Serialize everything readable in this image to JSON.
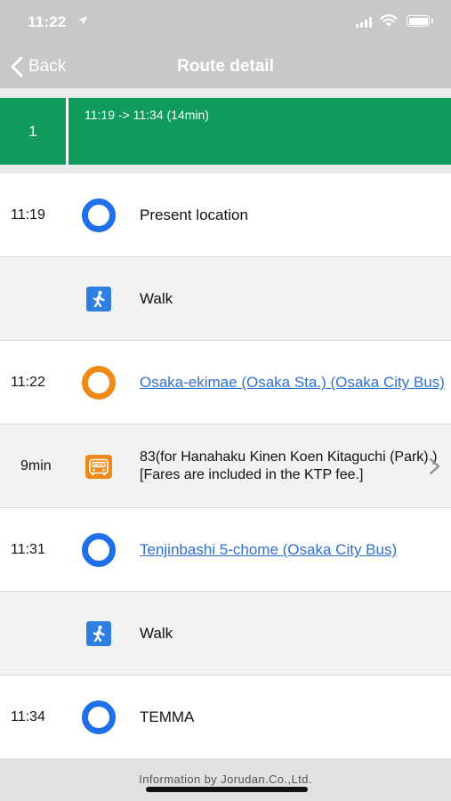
{
  "status_bar": {
    "time": "11:22"
  },
  "nav": {
    "back_label": "Back",
    "title": "Route detail"
  },
  "route_summary": {
    "number": "1",
    "time_range": "11:19 -> 11:34 (14min)"
  },
  "steps": [
    {
      "time": "11:19",
      "text": "Present location"
    },
    {
      "icon": "walk-icon",
      "text": "Walk"
    },
    {
      "time": "11:22",
      "text": "Osaka-ekimae (Osaka Sta.) (Osaka City Bus)"
    },
    {
      "duration": "9min",
      "icon": "bus-icon",
      "text": "83(for Hanahaku Kinen Koen Kitaguchi (Park) ) [Fares are included in the KTP fee.]"
    },
    {
      "time": "11:31",
      "text": "Tenjinbashi 5-chome (Osaka City Bus)"
    },
    {
      "icon": "walk-icon",
      "text": "Walk"
    },
    {
      "time": "11:34",
      "text": "TEMMA"
    }
  ],
  "colors": {
    "header_bg": "#c8c8c8",
    "route_green": "#109a5c",
    "walk_blue": "#1f6fe8",
    "bus_orange": "#ef8a19",
    "link_blue": "#2f6fd0"
  },
  "footer": {
    "text": "Information by Jorudan.Co.,Ltd."
  }
}
